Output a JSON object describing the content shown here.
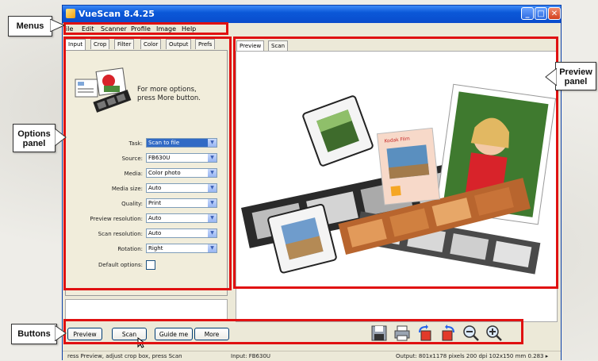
{
  "window": {
    "title": "VueScan 8.4.25",
    "controls": [
      "minimize-icon",
      "maximize-icon",
      "close-icon"
    ]
  },
  "menus": [
    "ile",
    "Edit",
    "Scanner",
    "Profile",
    "Image",
    "Help"
  ],
  "options_tabs": [
    "Input",
    "Crop",
    "Filter",
    "Color",
    "Output",
    "Prefs"
  ],
  "options_tabs_active": "Input",
  "info_text_1": "For more options,",
  "info_text_2": "press More button.",
  "settings": [
    {
      "label": "Task:",
      "value": "Scan to file",
      "highlighted": true
    },
    {
      "label": "Source:",
      "value": "FB630U"
    },
    {
      "label": "Media:",
      "value": "Color photo"
    },
    {
      "label": "Media size:",
      "value": "Auto"
    },
    {
      "label": "Quality:",
      "value": "Print"
    },
    {
      "label": "Preview resolution:",
      "value": "Auto"
    },
    {
      "label": "Scan resolution:",
      "value": "Auto"
    },
    {
      "label": "Rotation:",
      "value": "Right"
    }
  ],
  "default_options_label": "Default options:",
  "preview_tabs": [
    "Preview",
    "Scan"
  ],
  "preview_image_caption": "Kodak Film",
  "buttons": [
    "Preview",
    "Scan",
    "Guide me",
    "More"
  ],
  "toolbar_icons": [
    "save-icon",
    "print-icon",
    "rotate-left-icon",
    "rotate-right-icon",
    "zoom-out-icon",
    "zoom-in-icon"
  ],
  "status": {
    "left": "ress Preview, adjust crop box, press Scan",
    "middle": "Input: FB630U",
    "right": "Output: 801x1178 pixels 200 dpi 102x150 mm 0.283 ▸"
  },
  "annotations": {
    "menus": "Menus",
    "options_panel_1": "Options",
    "options_panel_2": "panel",
    "preview_panel_1": "Preview",
    "preview_panel_2": "panel",
    "buttons": "Buttons"
  },
  "colors": {
    "annotation": "#e01111",
    "titlebar": "#0b58d8",
    "selection": "#316ac5"
  }
}
